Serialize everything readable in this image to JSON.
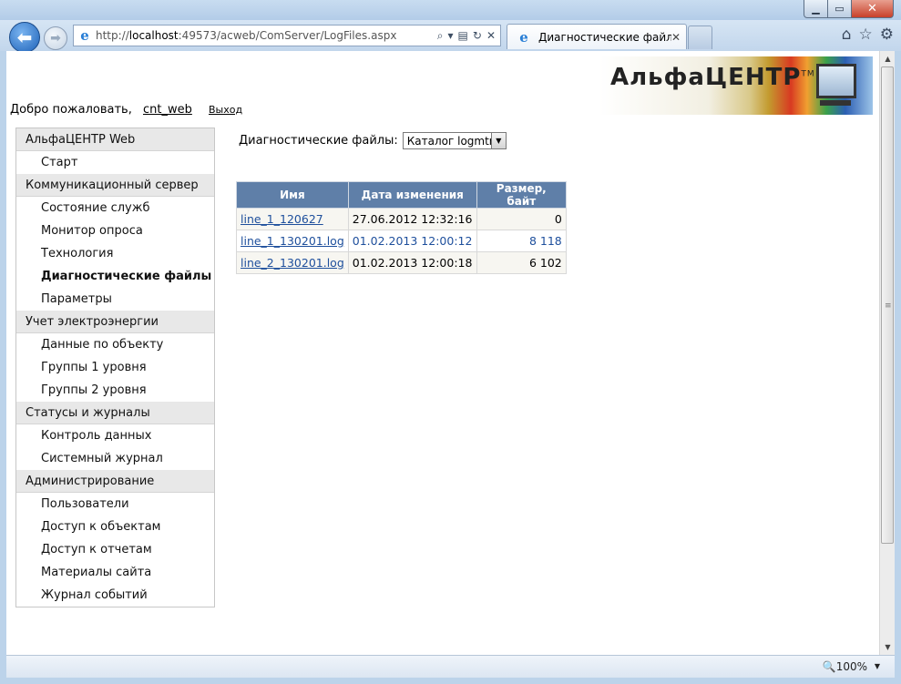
{
  "browser": {
    "url_prefix": "http://",
    "url_host": "localhost",
    "url_rest": ":49573/acweb/ComServer/LogFiles.aspx",
    "tab_title": "Диагностические файлы",
    "zoom": "100%"
  },
  "header": {
    "logo_text": "АльфаЦЕНТР",
    "logo_tm": "TM",
    "welcome_text": "Добро пожаловать,",
    "username": "cnt_web",
    "logout_label": "Выход"
  },
  "sidebar": {
    "groups": [
      {
        "label": "АльфаЦЕНТР Web",
        "items": [
          "Старт"
        ]
      },
      {
        "label": "Коммуникационный сервер",
        "items": [
          "Состояние служб",
          "Монитор опроса",
          "Технология",
          "Диагностические файлы",
          "Параметры"
        ]
      },
      {
        "label": "Учет электроэнергии",
        "items": [
          "Данные по объекту",
          "Группы 1 уровня",
          "Группы 2 уровня"
        ]
      },
      {
        "label": "Статусы и журналы",
        "items": [
          "Контроль данных",
          "Системный журнал"
        ]
      },
      {
        "label": "Администрирование",
        "items": [
          "Пользователи",
          "Доступ к объектам",
          "Доступ к отчетам",
          "Материалы сайта",
          "Журнал событий"
        ]
      }
    ]
  },
  "filter": {
    "label": "Диагностические файлы:",
    "selected": "Каталог logmtr"
  },
  "table": {
    "headers": [
      "Имя",
      "Дата изменения",
      "Размер, байт"
    ],
    "rows": [
      {
        "name": "line_1_120627",
        "date": "27.06.2012 12:32:16",
        "size": "0"
      },
      {
        "name": "line_1_130201.log",
        "date": "01.02.2013 12:00:12",
        "size": "8 118"
      },
      {
        "name": "line_2_130201.log",
        "date": "01.02.2013 12:00:18",
        "size": "6 102"
      }
    ]
  }
}
